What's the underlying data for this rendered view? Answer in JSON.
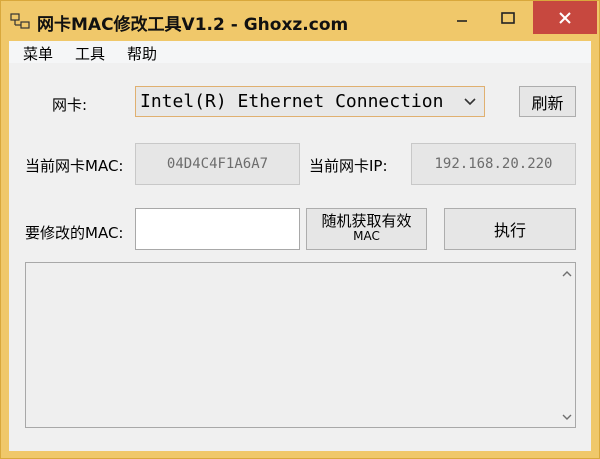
{
  "window": {
    "title": "网卡MAC修改工具V1.2 - Ghoxz.com",
    "icon": "network-adapter-icon"
  },
  "menu": [
    "菜单",
    "工具",
    "帮助"
  ],
  "adapter": {
    "label": "网卡:",
    "selected": "Intel(R) Ethernet Connection",
    "refresh_label": "刷新"
  },
  "current": {
    "mac_label": "当前网卡MAC:",
    "mac_value": "04D4C4F1A6A7",
    "ip_label": "当前网卡IP:",
    "ip_value": "192.168.20.220"
  },
  "modify": {
    "label": "要修改的MAC:",
    "input_value": "",
    "random_label_line1": "随机获取有效",
    "random_label_line2": "MAC",
    "execute_label": "执行"
  },
  "log": {
    "text": ""
  },
  "colors": {
    "titlebar": "#f0c86a",
    "close": "#c7483f",
    "client": "#f0f0f0"
  }
}
